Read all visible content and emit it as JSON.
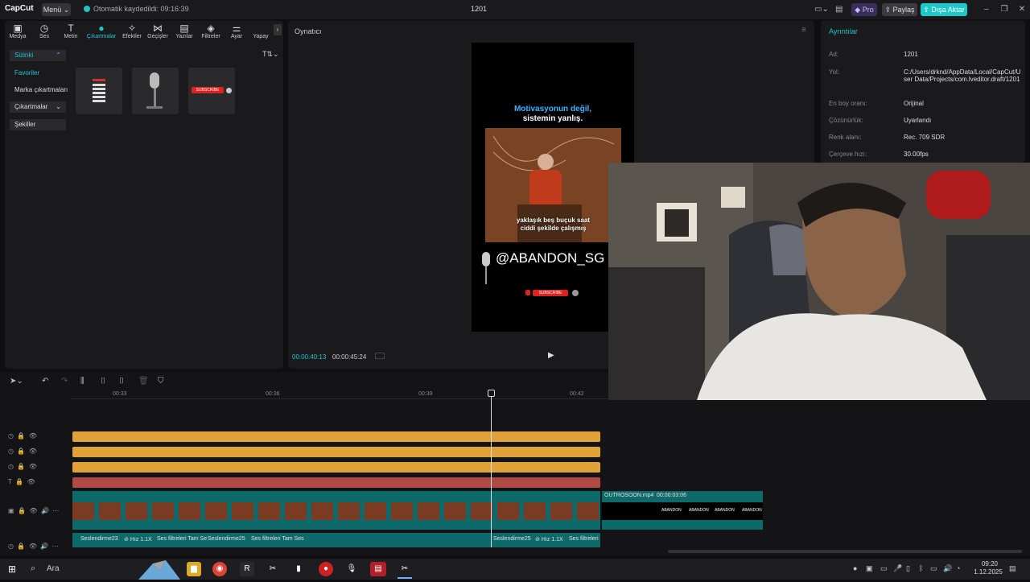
{
  "titlebar": {
    "logo": "CapCut",
    "menu_label": "Menü",
    "save_status": "Otomatik kaydedildi: 09:16:39",
    "project_title": "1201",
    "pro_label": "Pro",
    "share_label": "Paylaş",
    "export_label": "Dışa Aktar"
  },
  "tool_tabs": [
    {
      "label": "Medya",
      "icon": "media-icon"
    },
    {
      "label": "Ses",
      "icon": "audio-icon"
    },
    {
      "label": "Metin",
      "icon": "text-icon"
    },
    {
      "label": "Çıkartmalar",
      "icon": "sticker-icon"
    },
    {
      "label": "Efektler",
      "icon": "effects-icon"
    },
    {
      "label": "Geçişler",
      "icon": "transitions-icon"
    },
    {
      "label": "Yazılar",
      "icon": "captions-icon"
    },
    {
      "label": "Filtreler",
      "icon": "filters-icon"
    },
    {
      "label": "Ayar",
      "icon": "adjust-icon"
    },
    {
      "label": "Yapay",
      "icon": "ai-icon"
    }
  ],
  "sidebar": {
    "items": [
      "Sizinki",
      "Favoriler",
      "Marka çıkartmaları",
      "Çıkartmalar",
      "Şekiller"
    ]
  },
  "player": {
    "title": "Oynatıcı",
    "video_title_line1": "Motivasyonun değil,",
    "video_title_line2": "sistemin yanlış.",
    "subtitle_line1": "yaklaşık beş buçuk saat",
    "subtitle_line2": "ciddi şekilde çalışmış",
    "handle": "@ABANDON_SG",
    "subscribe": "SUBSCRIBE",
    "current_time": "00:00:40:13",
    "total_time": "00:00:45:24"
  },
  "details": {
    "title": "Ayrıntılar",
    "rows": [
      {
        "label": "Ad:",
        "value": "1201"
      },
      {
        "label": "Yol:",
        "value": "C:/Users/drknd/AppData/Local/CapCut/User Data/Projects/com.lveditor.draft/1201"
      },
      {
        "label": "En boy oranı:",
        "value": "Orijinal"
      },
      {
        "label": "Çözünürlük:",
        "value": "Uyarlandı"
      },
      {
        "label": "Renk alanı:",
        "value": "Rec. 709 SDR"
      },
      {
        "label": "Çerçeve hızı:",
        "value": "30.00fps"
      }
    ]
  },
  "timeline": {
    "ruler": [
      "00:33",
      "00:36",
      "00:39",
      "00:42"
    ],
    "outro_clip": "OUTROSOON.mp4",
    "outro_duration": "00:00:03:06",
    "outro_words": [
      "ABANDON",
      "ABANDON",
      "ABANDON",
      "ABANDON"
    ],
    "audio_labels_a": [
      "Seslendirme23",
      "Hız 1.1X",
      "Ses filtreleri Tam Se",
      "Seslendirme25",
      "Ses filtreleri Tam Ses"
    ],
    "audio_labels_b": [
      "Seslendirme25",
      "Hız 1.1X",
      "Ses filtreleri"
    ]
  },
  "taskbar": {
    "search_label": "Ara",
    "time": "09:20",
    "date": "1.12.2025"
  },
  "colors": {
    "accent": "#20c6d4",
    "sticker_track": "#e2a23a",
    "text_track": "#b04a44",
    "video_track": "#0e6a6a"
  }
}
